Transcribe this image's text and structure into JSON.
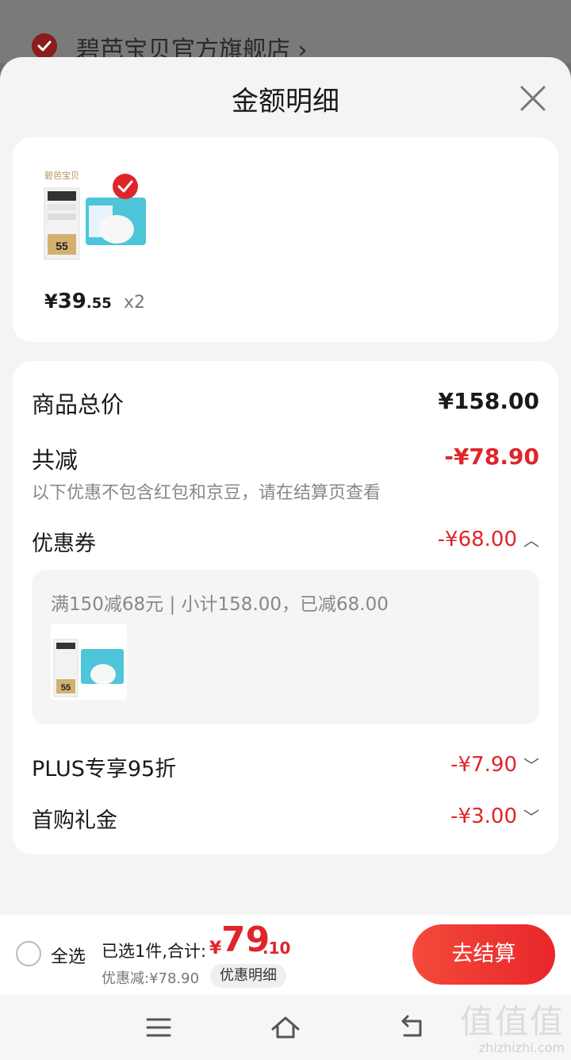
{
  "background": {
    "store_name": "碧芭宝贝官方旗舰店 ›"
  },
  "sheet": {
    "title": "金额明细"
  },
  "product": {
    "price_symbol": "¥",
    "price_int": "39",
    "price_dec": ".55",
    "quantity": "x2",
    "image_brand": "碧芭宝贝",
    "image_badge": "55"
  },
  "detail": {
    "total_label": "商品总价",
    "total_value": "¥158.00",
    "reduce_label": "共减",
    "reduce_value": "-¥78.90",
    "note": "以下优惠不包含红包和京豆，请在结算页查看",
    "items": [
      {
        "label": "优惠券",
        "value": "-¥68.00",
        "chevron": "︿",
        "expanded": true
      },
      {
        "label": "PLUS专享95折",
        "value": "-¥7.90",
        "chevron": "﹀",
        "expanded": false
      },
      {
        "label": "首购礼金",
        "value": "-¥3.00",
        "chevron": "﹀",
        "expanded": false
      }
    ],
    "coupon_text": "满150减68元 | 小计158.00，已减68.00"
  },
  "bottom": {
    "select_all": "全选",
    "selected_text": "已选1件,合计:",
    "total_currency": "¥",
    "total_int": "79",
    "total_dec": ".10",
    "discount_text": "优惠减:¥78.90",
    "detail_pill": "优惠明细",
    "checkout": "去结算"
  },
  "watermark": {
    "big": "值值值",
    "small": "zhizhizhi.com"
  },
  "colors": {
    "accent_red": "#e0252a",
    "checkout_gradient_start": "#f44a3a",
    "checkout_gradient_end": "#e8262b"
  }
}
